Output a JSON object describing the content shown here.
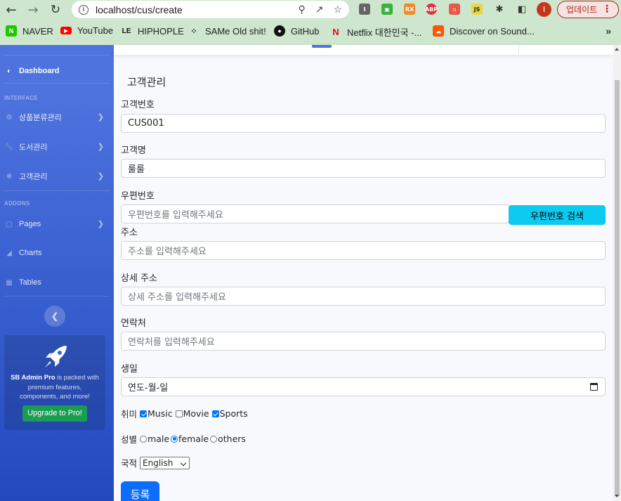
{
  "browser": {
    "url": "localhost/cus/create",
    "profile_initial": "I",
    "update_label": "업데이트",
    "bookmarks": [
      "NAVER",
      "YouTube",
      "HIPHOPLE",
      "SAMe Old shit!",
      "GitHub",
      "Netflix 대한민국 -...",
      "Discover on Sound..."
    ],
    "bookmarks_more": "»"
  },
  "sidebar": {
    "dashboard": "Dashboard",
    "heading_interface": "INTERFACE",
    "item_category": "상품분류관리",
    "item_books": "도서관리",
    "item_customers": "고객관리",
    "heading_addons": "ADDONS",
    "item_pages": "Pages",
    "item_charts": "Charts",
    "item_tables": "Tables",
    "promo_brand": "SB Admin Pro",
    "promo_text": " is packed with premium features, components, and more!",
    "promo_button": "Upgrade to Pro!"
  },
  "form": {
    "title": "고객관리",
    "customer_no_label": "고객번호",
    "customer_no_value": "CUS001",
    "name_label": "고객명",
    "name_value": "룰룰",
    "zipcode_label": "우편번호",
    "zipcode_placeholder": "우편번호를 입력해주세요",
    "zipcode_search": "우편번호 검색",
    "address_label": "주소",
    "address_placeholder": "주소를 입력해주세요",
    "address_detail_label": "상세 주소",
    "address_detail_placeholder": "상세 주소를 입력해주세요",
    "phone_label": "연락처",
    "phone_placeholder": "연락처를 입력해주세요",
    "birth_label": "생일",
    "birth_placeholder": "연도-월-일",
    "hobby_label": "취미",
    "hobbies": [
      {
        "label": "Music",
        "checked": true
      },
      {
        "label": "Movie",
        "checked": false
      },
      {
        "label": "Sports",
        "checked": true
      }
    ],
    "gender_label": "성별",
    "genders": [
      {
        "label": "male",
        "selected": false
      },
      {
        "label": "female",
        "selected": true
      },
      {
        "label": "others",
        "selected": false
      }
    ],
    "nation_label": "국적",
    "nation_value": "English",
    "submit_label": "등록"
  }
}
